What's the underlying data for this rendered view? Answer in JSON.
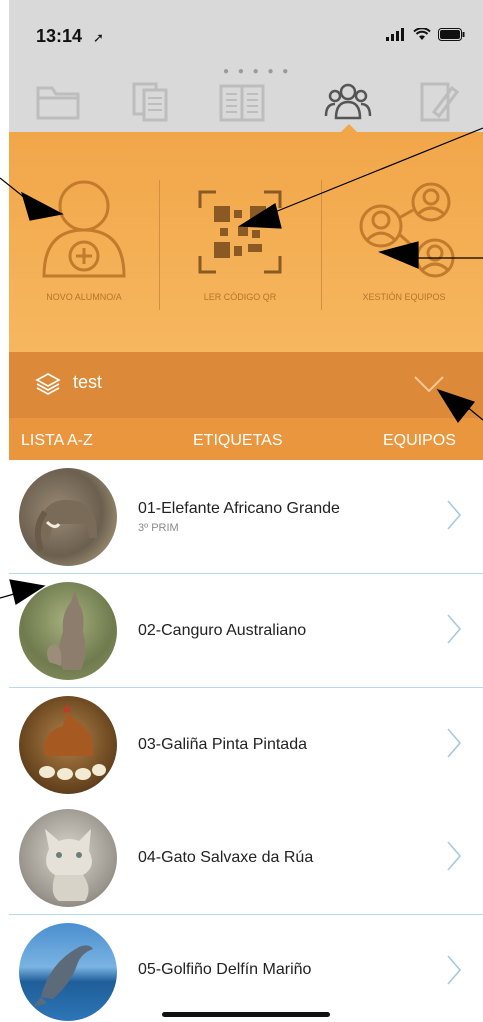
{
  "status_bar": {
    "time": "13:14"
  },
  "actions": [
    {
      "label": "NOVO ALUMNO/A",
      "icon": "add-student-icon"
    },
    {
      "label": "LER CÓDIGO QR",
      "icon": "qr-code-icon"
    },
    {
      "label": "XESTIÓN EQUIPOS",
      "icon": "team-management-icon"
    }
  ],
  "group": {
    "name": "test"
  },
  "tabs": [
    "LISTA A-Z",
    "ETIQUETAS",
    "EQUIPOS"
  ],
  "students": [
    {
      "name": "01-Elefante Africano Grande",
      "class": "3º PRIM"
    },
    {
      "name": "02-Canguro Australiano",
      "class": ""
    },
    {
      "name": "03-Galiña Pinta Pintada",
      "class": ""
    },
    {
      "name": "04-Gato Salvaxe da Rúa",
      "class": ""
    },
    {
      "name": "05-Golfiño Delfín Mariño",
      "class": ""
    }
  ],
  "colors": {
    "orange": "#f2a64a",
    "group_bar": "#dc8a3a",
    "tab_bar": "#e9963e",
    "divider": "#bcd8ea"
  }
}
